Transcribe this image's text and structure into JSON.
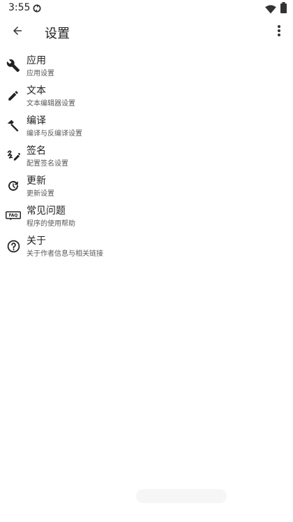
{
  "status_bar": {
    "time": "3:55",
    "icons": [
      "sync-icon",
      "wifi-icon",
      "battery-icon"
    ]
  },
  "app_bar": {
    "title": "设置",
    "back_icon": "arrow-back-icon",
    "menu_icon": "more-vert-icon"
  },
  "settings": {
    "items": [
      {
        "icon": "wrench-icon",
        "title": "应用",
        "subtitle": "应用设置"
      },
      {
        "icon": "pencil-icon",
        "title": "文本",
        "subtitle": "文本编辑器设置"
      },
      {
        "icon": "hammer-icon",
        "title": "编译",
        "subtitle": "编译与反编译设置"
      },
      {
        "icon": "signature-icon",
        "title": "签名",
        "subtitle": "配置签名设置"
      },
      {
        "icon": "update-icon",
        "title": "更新",
        "subtitle": "更新设置"
      },
      {
        "icon": "faq-icon",
        "title": "常见问题",
        "subtitle": "程序的使用帮助"
      },
      {
        "icon": "help-circle-icon",
        "title": "关于",
        "subtitle": "关于作者信息与相关链接"
      }
    ]
  },
  "colors": {
    "background": "#ffffff",
    "icon": "#222222",
    "subtitle": "#5a5a5a"
  }
}
